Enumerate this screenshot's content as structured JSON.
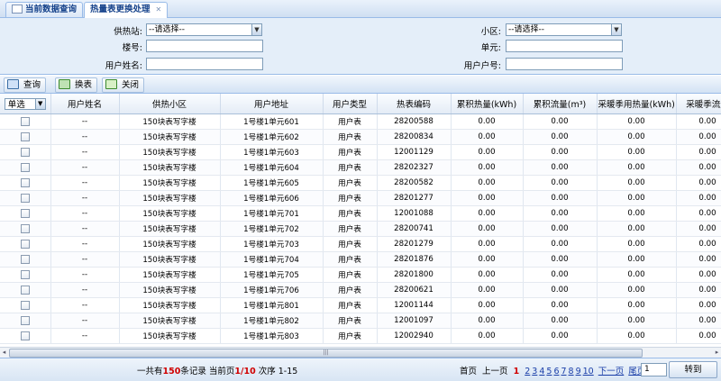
{
  "tabs": [
    {
      "label": "当前数据查询"
    },
    {
      "label": "热量表更换处理"
    }
  ],
  "filters": {
    "supply_station": {
      "label": "供热站:",
      "value": "--请选择--"
    },
    "community": {
      "label": "小区:",
      "value": "--请选择--"
    },
    "building": {
      "label": "楼号:",
      "value": ""
    },
    "unit": {
      "label": "单元:",
      "value": ""
    },
    "user_name": {
      "label": "用户姓名:",
      "value": ""
    },
    "user_account": {
      "label": "用户户号:",
      "value": ""
    }
  },
  "toolbar": {
    "query": "查询",
    "swap": "换表",
    "close": "关闭"
  },
  "grid": {
    "select_label": "单选",
    "columns": [
      "用户姓名",
      "供热小区",
      "用户地址",
      "用户类型",
      "热表编码",
      "累积热量(kWh)",
      "累积流量(m³)",
      "采暖季用热量(kWh)",
      "采暖季流量"
    ],
    "rows": [
      [
        "--",
        "150块表写字楼",
        "1号楼1单元601",
        "用户表",
        "28200588",
        "0.00",
        "0.00",
        "0.00",
        "0.00"
      ],
      [
        "--",
        "150块表写字楼",
        "1号楼1单元602",
        "用户表",
        "28200834",
        "0.00",
        "0.00",
        "0.00",
        "0.00"
      ],
      [
        "--",
        "150块表写字楼",
        "1号楼1单元603",
        "用户表",
        "12001129",
        "0.00",
        "0.00",
        "0.00",
        "0.00"
      ],
      [
        "--",
        "150块表写字楼",
        "1号楼1单元604",
        "用户表",
        "28202327",
        "0.00",
        "0.00",
        "0.00",
        "0.00"
      ],
      [
        "--",
        "150块表写字楼",
        "1号楼1单元605",
        "用户表",
        "28200582",
        "0.00",
        "0.00",
        "0.00",
        "0.00"
      ],
      [
        "--",
        "150块表写字楼",
        "1号楼1单元606",
        "用户表",
        "28201277",
        "0.00",
        "0.00",
        "0.00",
        "0.00"
      ],
      [
        "--",
        "150块表写字楼",
        "1号楼1单元701",
        "用户表",
        "12001088",
        "0.00",
        "0.00",
        "0.00",
        "0.00"
      ],
      [
        "--",
        "150块表写字楼",
        "1号楼1单元702",
        "用户表",
        "28200741",
        "0.00",
        "0.00",
        "0.00",
        "0.00"
      ],
      [
        "--",
        "150块表写字楼",
        "1号楼1单元703",
        "用户表",
        "28201279",
        "0.00",
        "0.00",
        "0.00",
        "0.00"
      ],
      [
        "--",
        "150块表写字楼",
        "1号楼1单元704",
        "用户表",
        "28201876",
        "0.00",
        "0.00",
        "0.00",
        "0.00"
      ],
      [
        "--",
        "150块表写字楼",
        "1号楼1单元705",
        "用户表",
        "28201800",
        "0.00",
        "0.00",
        "0.00",
        "0.00"
      ],
      [
        "--",
        "150块表写字楼",
        "1号楼1单元706",
        "用户表",
        "28200621",
        "0.00",
        "0.00",
        "0.00",
        "0.00"
      ],
      [
        "--",
        "150块表写字楼",
        "1号楼1单元801",
        "用户表",
        "12001144",
        "0.00",
        "0.00",
        "0.00",
        "0.00"
      ],
      [
        "--",
        "150块表写字楼",
        "1号楼1单元802",
        "用户表",
        "12001097",
        "0.00",
        "0.00",
        "0.00",
        "0.00"
      ],
      [
        "--",
        "150块表写字楼",
        "1号楼1单元803",
        "用户表",
        "12002940",
        "0.00",
        "0.00",
        "0.00",
        "0.00"
      ]
    ]
  },
  "pager": {
    "summary_prefix": "一共有",
    "total": "150",
    "summary_mid": "条记录 当前页",
    "current": "1/10",
    "summary_suffix": " 次序 1-15",
    "first": "首页",
    "prev": "上一页",
    "current_page": "1",
    "pages": [
      "2",
      "3",
      "4",
      "5",
      "6",
      "7",
      "8",
      "9",
      "10"
    ],
    "next": "下一页",
    "last": "尾页",
    "jump_value": "1",
    "go": "转到"
  },
  "colors": {
    "accent": "#15428b",
    "border": "#99bbe8",
    "highlight": "#d00000"
  }
}
